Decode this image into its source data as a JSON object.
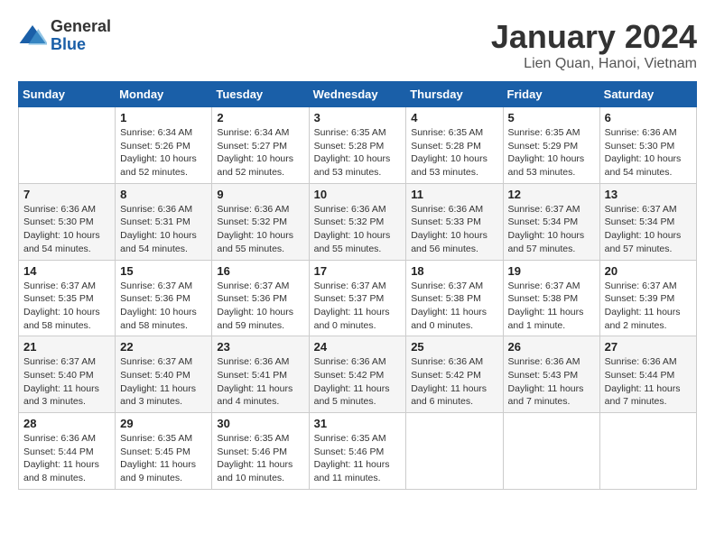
{
  "logo": {
    "text_general": "General",
    "text_blue": "Blue"
  },
  "header": {
    "title": "January 2024",
    "subtitle": "Lien Quan, Hanoi, Vietnam"
  },
  "weekdays": [
    "Sunday",
    "Monday",
    "Tuesday",
    "Wednesday",
    "Thursday",
    "Friday",
    "Saturday"
  ],
  "weeks": [
    [
      {
        "day": "",
        "info": ""
      },
      {
        "day": "1",
        "info": "Sunrise: 6:34 AM\nSunset: 5:26 PM\nDaylight: 10 hours\nand 52 minutes."
      },
      {
        "day": "2",
        "info": "Sunrise: 6:34 AM\nSunset: 5:27 PM\nDaylight: 10 hours\nand 52 minutes."
      },
      {
        "day": "3",
        "info": "Sunrise: 6:35 AM\nSunset: 5:28 PM\nDaylight: 10 hours\nand 53 minutes."
      },
      {
        "day": "4",
        "info": "Sunrise: 6:35 AM\nSunset: 5:28 PM\nDaylight: 10 hours\nand 53 minutes."
      },
      {
        "day": "5",
        "info": "Sunrise: 6:35 AM\nSunset: 5:29 PM\nDaylight: 10 hours\nand 53 minutes."
      },
      {
        "day": "6",
        "info": "Sunrise: 6:36 AM\nSunset: 5:30 PM\nDaylight: 10 hours\nand 54 minutes."
      }
    ],
    [
      {
        "day": "7",
        "info": "Sunrise: 6:36 AM\nSunset: 5:30 PM\nDaylight: 10 hours\nand 54 minutes."
      },
      {
        "day": "8",
        "info": "Sunrise: 6:36 AM\nSunset: 5:31 PM\nDaylight: 10 hours\nand 54 minutes."
      },
      {
        "day": "9",
        "info": "Sunrise: 6:36 AM\nSunset: 5:32 PM\nDaylight: 10 hours\nand 55 minutes."
      },
      {
        "day": "10",
        "info": "Sunrise: 6:36 AM\nSunset: 5:32 PM\nDaylight: 10 hours\nand 55 minutes."
      },
      {
        "day": "11",
        "info": "Sunrise: 6:36 AM\nSunset: 5:33 PM\nDaylight: 10 hours\nand 56 minutes."
      },
      {
        "day": "12",
        "info": "Sunrise: 6:37 AM\nSunset: 5:34 PM\nDaylight: 10 hours\nand 57 minutes."
      },
      {
        "day": "13",
        "info": "Sunrise: 6:37 AM\nSunset: 5:34 PM\nDaylight: 10 hours\nand 57 minutes."
      }
    ],
    [
      {
        "day": "14",
        "info": "Sunrise: 6:37 AM\nSunset: 5:35 PM\nDaylight: 10 hours\nand 58 minutes."
      },
      {
        "day": "15",
        "info": "Sunrise: 6:37 AM\nSunset: 5:36 PM\nDaylight: 10 hours\nand 58 minutes."
      },
      {
        "day": "16",
        "info": "Sunrise: 6:37 AM\nSunset: 5:36 PM\nDaylight: 10 hours\nand 59 minutes."
      },
      {
        "day": "17",
        "info": "Sunrise: 6:37 AM\nSunset: 5:37 PM\nDaylight: 11 hours\nand 0 minutes."
      },
      {
        "day": "18",
        "info": "Sunrise: 6:37 AM\nSunset: 5:38 PM\nDaylight: 11 hours\nand 0 minutes."
      },
      {
        "day": "19",
        "info": "Sunrise: 6:37 AM\nSunset: 5:38 PM\nDaylight: 11 hours\nand 1 minute."
      },
      {
        "day": "20",
        "info": "Sunrise: 6:37 AM\nSunset: 5:39 PM\nDaylight: 11 hours\nand 2 minutes."
      }
    ],
    [
      {
        "day": "21",
        "info": "Sunrise: 6:37 AM\nSunset: 5:40 PM\nDaylight: 11 hours\nand 3 minutes."
      },
      {
        "day": "22",
        "info": "Sunrise: 6:37 AM\nSunset: 5:40 PM\nDaylight: 11 hours\nand 3 minutes."
      },
      {
        "day": "23",
        "info": "Sunrise: 6:36 AM\nSunset: 5:41 PM\nDaylight: 11 hours\nand 4 minutes."
      },
      {
        "day": "24",
        "info": "Sunrise: 6:36 AM\nSunset: 5:42 PM\nDaylight: 11 hours\nand 5 minutes."
      },
      {
        "day": "25",
        "info": "Sunrise: 6:36 AM\nSunset: 5:42 PM\nDaylight: 11 hours\nand 6 minutes."
      },
      {
        "day": "26",
        "info": "Sunrise: 6:36 AM\nSunset: 5:43 PM\nDaylight: 11 hours\nand 7 minutes."
      },
      {
        "day": "27",
        "info": "Sunrise: 6:36 AM\nSunset: 5:44 PM\nDaylight: 11 hours\nand 7 minutes."
      }
    ],
    [
      {
        "day": "28",
        "info": "Sunrise: 6:36 AM\nSunset: 5:44 PM\nDaylight: 11 hours\nand 8 minutes."
      },
      {
        "day": "29",
        "info": "Sunrise: 6:35 AM\nSunset: 5:45 PM\nDaylight: 11 hours\nand 9 minutes."
      },
      {
        "day": "30",
        "info": "Sunrise: 6:35 AM\nSunset: 5:46 PM\nDaylight: 11 hours\nand 10 minutes."
      },
      {
        "day": "31",
        "info": "Sunrise: 6:35 AM\nSunset: 5:46 PM\nDaylight: 11 hours\nand 11 minutes."
      },
      {
        "day": "",
        "info": ""
      },
      {
        "day": "",
        "info": ""
      },
      {
        "day": "",
        "info": ""
      }
    ]
  ]
}
